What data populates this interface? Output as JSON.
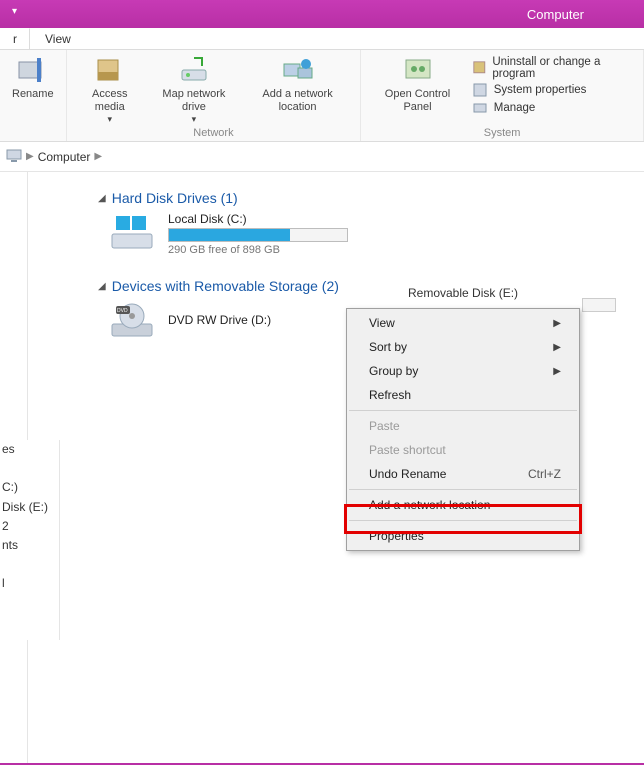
{
  "title": "Computer",
  "tabs": {
    "left": "r",
    "view": "View"
  },
  "ribbon": {
    "rename": "Rename",
    "access_media": "Access media",
    "map_network": "Map network drive",
    "add_network": "Add a network location",
    "network_group": "Network",
    "open_control": "Open Control Panel",
    "uninstall": "Uninstall or change a program",
    "sys_props": "System properties",
    "manage": "Manage",
    "system_group": "System"
  },
  "breadcrumb": {
    "root": "Computer"
  },
  "sidebar_items": {
    "a": "es",
    "b": "C:)",
    "c": "Disk (E:)",
    "d": "2",
    "e": "nts",
    "f": "l"
  },
  "categories": {
    "hdd": "Hard Disk Drives (1)",
    "local_disk": "Local Disk (C:)",
    "local_free": "290 GB free of 898 GB",
    "removable": "Devices with Removable Storage (2)",
    "dvd": "DVD RW Drive (D:)",
    "usb": "Removable Disk (E:)"
  },
  "menu": {
    "view": "View",
    "sortby": "Sort by",
    "groupby": "Group by",
    "refresh": "Refresh",
    "paste": "Paste",
    "paste_shortcut": "Paste shortcut",
    "undo": "Undo Rename",
    "undo_sc": "Ctrl+Z",
    "add_loc": "Add a network location",
    "properties": "Properties"
  }
}
